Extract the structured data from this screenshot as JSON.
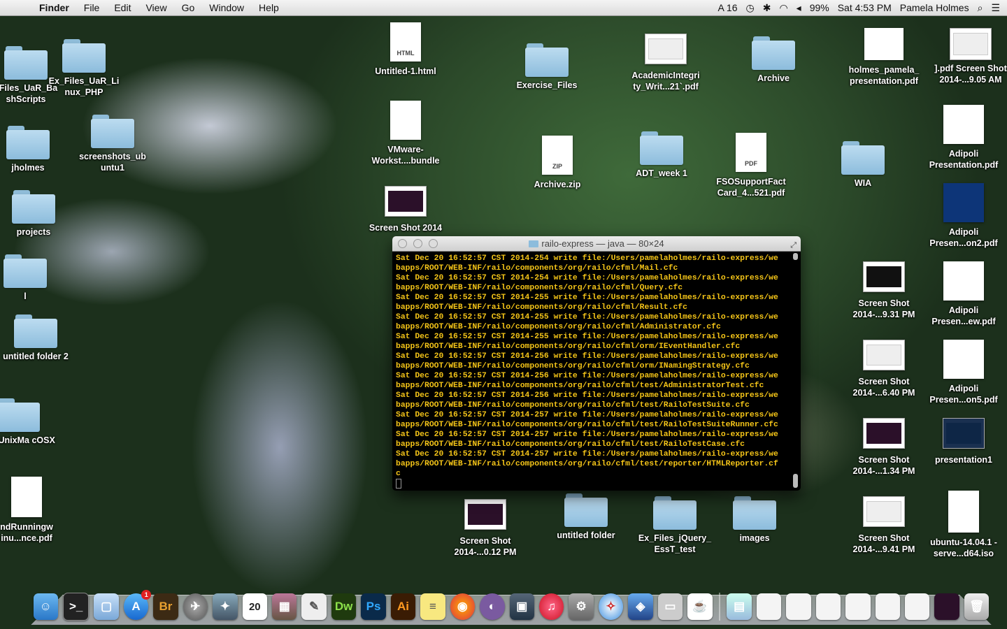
{
  "menubar": {
    "apple": "",
    "app": "Finder",
    "items": [
      "File",
      "Edit",
      "View",
      "Go",
      "Window",
      "Help"
    ],
    "right": {
      "ai": "A 16",
      "battery": "99%",
      "clock": "Sat 4:53 PM",
      "user": "Pamela Holmes"
    }
  },
  "desktop": {
    "exfiles_bashscripts": "_Files_UaR_Ba shScripts",
    "exfiles_linux_php": "Ex_Files_UaR_Li nux_PHP",
    "jholmes": "jholmes",
    "screenshots_ubuntu1": "screenshots_ub untu1",
    "projects": "projects",
    "l": "l",
    "untitled_folder_2": "untitled folder 2",
    "exfiles_unixmacosx": "les_UnixMa cOSX",
    "runningw_pdf": "ndRunningw inu...nce.pdf",
    "untitled_html": "Untitled-1.html",
    "vmware_bundle": "VMware- Workst....bundle",
    "screenshot_top": "Screen Shot 2014",
    "exercise_files": "Exercise_Files",
    "archive_zip": "Archive.zip",
    "academic_pdf": "AcademicIntegri ty_Writ...21`.pdf",
    "adt_week1": "ADT_week 1",
    "fso_pdf": "FSOSupportFact Card_4...521.pdf",
    "archive": "Archive",
    "wia": "WIA",
    "holmes_presentation": "holmes_pamela_ presentation.pdf",
    "jpdf_screenshot": "].pdf Screen Shot 2014-...9.05 AM",
    "adipoli_presentation": "Adipoli Presentation.pdf",
    "adipoli_on2": "Adipoli Presen...on2.pdf",
    "screenshot_931": "Screen Shot 2014-...9.31 PM",
    "adipoli_ew": "Adipoli Presen...ew.pdf",
    "screenshot_640": "Screen Shot 2014-...6.40 PM",
    "adipoli_on5": "Adipoli Presen...on5.pdf",
    "screenshot_134": "Screen Shot 2014-...1.34 PM",
    "presentation1": "presentation1",
    "screenshot_941": "Screen Shot 2014-...9.41 PM",
    "ubuntu_iso": "ubuntu-14.04.1 -serve...d64.iso",
    "screenshot_012": "Screen Shot 2014-...0.12 PM",
    "untitled_folder": "untitled folder",
    "exfiles_jquery": "Ex_Files_jQuery_ EssT_test",
    "images": "images"
  },
  "terminal": {
    "title": "railo-express — java — 80×24",
    "lines": [
      "Sat Dec 20 16:52:57 CST 2014-254 write file:/Users/pamelaholmes/railo-express/we",
      "bapps/ROOT/WEB-INF/railo/components/org/railo/cfml/Mail.cfc",
      "Sat Dec 20 16:52:57 CST 2014-254 write file:/Users/pamelaholmes/railo-express/we",
      "bapps/ROOT/WEB-INF/railo/components/org/railo/cfml/Query.cfc",
      "Sat Dec 20 16:52:57 CST 2014-255 write file:/Users/pamelaholmes/railo-express/we",
      "bapps/ROOT/WEB-INF/railo/components/org/railo/cfml/Result.cfc",
      "Sat Dec 20 16:52:57 CST 2014-255 write file:/Users/pamelaholmes/railo-express/we",
      "bapps/ROOT/WEB-INF/railo/components/org/railo/cfml/Administrator.cfc",
      "Sat Dec 20 16:52:57 CST 2014-255 write file:/Users/pamelaholmes/railo-express/we",
      "bapps/ROOT/WEB-INF/railo/components/org/railo/cfml/orm/IEventHandler.cfc",
      "Sat Dec 20 16:52:57 CST 2014-256 write file:/Users/pamelaholmes/railo-express/we",
      "bapps/ROOT/WEB-INF/railo/components/org/railo/cfml/orm/INamingStrategy.cfc",
      "Sat Dec 20 16:52:57 CST 2014-256 write file:/Users/pamelaholmes/railo-express/we",
      "bapps/ROOT/WEB-INF/railo/components/org/railo/cfml/test/AdministratorTest.cfc",
      "Sat Dec 20 16:52:57 CST 2014-256 write file:/Users/pamelaholmes/railo-express/we",
      "bapps/ROOT/WEB-INF/railo/components/org/railo/cfml/test/RailoTestSuite.cfc",
      "Sat Dec 20 16:52:57 CST 2014-257 write file:/Users/pamelaholmes/railo-express/we",
      "bapps/ROOT/WEB-INF/railo/components/org/railo/cfml/test/RailoTestSuiteRunner.cfc",
      "Sat Dec 20 16:52:57 CST 2014-257 write file:/Users/pamelaholmes/railo-express/we",
      "bapps/ROOT/WEB-INF/railo/components/org/railo/cfml/test/RailoTestCase.cfc",
      "Sat Dec 20 16:52:57 CST 2014-257 write file:/Users/pamelaholmes/railo-express/we",
      "bapps/ROOT/WEB-INF/railo/components/org/railo/cfml/test/reporter/HTMLReporter.cf",
      "c"
    ]
  },
  "dock": {
    "br": "Br",
    "dw": "Dw",
    "ps": "Ps",
    "ai": "Ai",
    "appstore_badge": "1",
    "calendar_day": "20"
  },
  "colors": {
    "terminal_text": "#f5c518",
    "folder": "#9cc8e4"
  }
}
